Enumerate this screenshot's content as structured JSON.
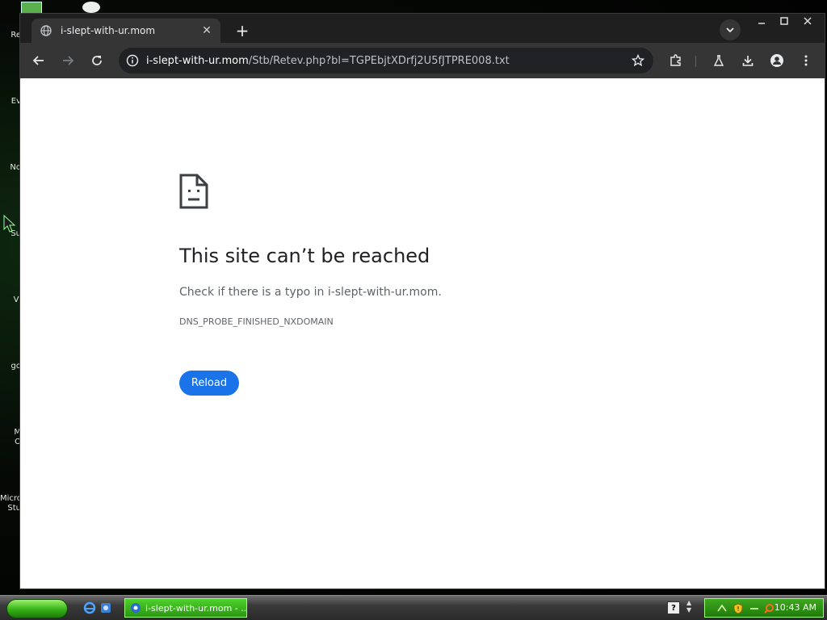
{
  "desktop": {
    "icon_labels": [
      "Re",
      "Ev",
      "No",
      "Su",
      "Vi",
      "go",
      "M\nO",
      "Micro\nStu"
    ]
  },
  "browser": {
    "tab": {
      "title": "i-slept-with-ur.mom",
      "favicon": "globe-icon"
    },
    "new_tab_label": "+",
    "address": {
      "host": "i-slept-with-ur.mom",
      "path": "/Stb/Retev.php?bl=TGPEbjtXDrfj2U5fJTPRE008.txt"
    },
    "toolbar_icons": [
      "back-icon",
      "forward-icon",
      "reload-icon",
      "info-icon",
      "bookmark-star-icon",
      "extensions-icon",
      "labs-icon",
      "download-icon",
      "profile-icon",
      "menu-dots-icon"
    ]
  },
  "error_page": {
    "icon": "sad-page-icon",
    "title": "This site can’t be reached",
    "subtitle": "Check if there is a typo in i-slept-with-ur.mom.",
    "code": "DNS_PROBE_FINISHED_NXDOMAIN",
    "reload_label": "Reload",
    "accent": "#1a73e8"
  },
  "taskbar": {
    "active_task": "i-slept-with-ur.mom - ...",
    "clock": "10:43 AM",
    "help_glyph": "?"
  }
}
